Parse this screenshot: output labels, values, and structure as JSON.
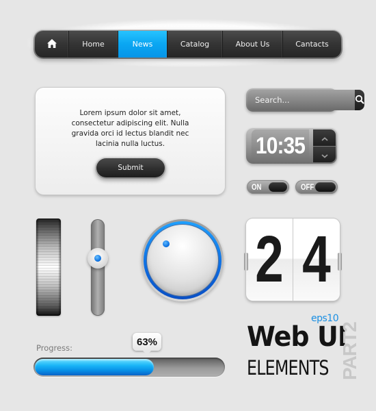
{
  "nav": {
    "items": [
      {
        "label": "",
        "icon": "home-icon",
        "active": false
      },
      {
        "label": "Home",
        "active": false
      },
      {
        "label": "News",
        "active": true
      },
      {
        "label": "Catalog",
        "active": false
      },
      {
        "label": "About Us",
        "active": false
      },
      {
        "label": "Cantacts",
        "active": false
      }
    ],
    "accent_color": "#0aa6f2"
  },
  "panel": {
    "text": "Lorem ipsum dolor sit amet, consectetur adipiscing elit. Nulla gravida orci id lectus blandit nec lacinia nulla luctus.",
    "submit_label": "Submit"
  },
  "search": {
    "placeholder": "Search...",
    "value": "",
    "button_icon": "search-icon"
  },
  "clock": {
    "time": "10:35",
    "up_icon": "chevron-up-icon",
    "down_icon": "chevron-down-icon"
  },
  "toggles": [
    {
      "label": "ON"
    },
    {
      "label": "OFF"
    }
  ],
  "vertical_slider": {
    "value_fraction": 0.38
  },
  "flip_counter": {
    "digits": [
      "2",
      "4"
    ]
  },
  "progress": {
    "label": "Progress:",
    "percent": 63,
    "tooltip": "63%"
  },
  "branding": {
    "eps": "eps10",
    "title_line1": "Web UI",
    "title_line2": "ELEMENTS",
    "part": "PART2",
    "eps_color": "#1a8fe3"
  }
}
